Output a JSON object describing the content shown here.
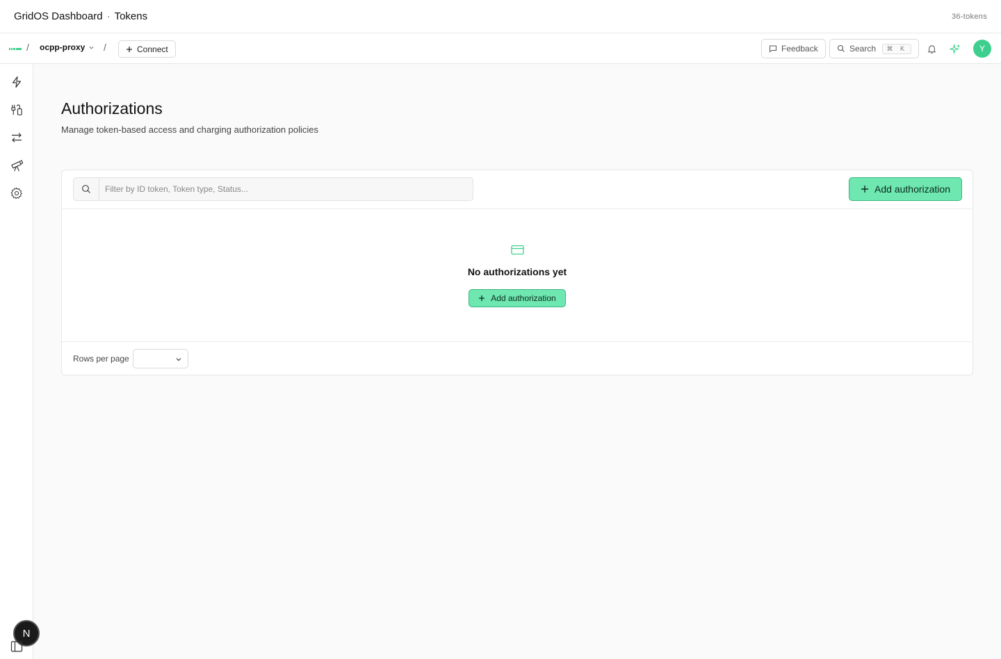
{
  "window": {
    "title": "GridOS Dashboard",
    "separator": "·",
    "section": "Tokens",
    "tag": "36-tokens"
  },
  "topbar": {
    "breadcrumb_sep": "/",
    "project": "ocpp-proxy",
    "connect_label": "Connect",
    "feedback_label": "Feedback",
    "search_label": "Search",
    "search_shortcut": "⌘ K",
    "avatar_initial": "Y"
  },
  "sidebar": {
    "items": [
      {
        "icon": "lightning-icon"
      },
      {
        "icon": "connectors-icon"
      },
      {
        "icon": "transfer-icon"
      },
      {
        "icon": "telescope-icon"
      },
      {
        "icon": "gear-icon"
      }
    ],
    "bottom_badge": "N"
  },
  "main": {
    "title": "Authorizations",
    "subtitle": "Manage token-based access and charging authorization policies",
    "filter_placeholder": "Filter by ID token, Token type, Status...",
    "add_button": "Add authorization",
    "empty_message": "No authorizations yet",
    "empty_add_button": "Add authorization",
    "rows_per_page_label": "Rows per page",
    "rows_per_page_value": ""
  },
  "colors": {
    "accent": "#3ecf8e",
    "button_fill": "#6ee7b0",
    "button_border": "#37b67c"
  }
}
